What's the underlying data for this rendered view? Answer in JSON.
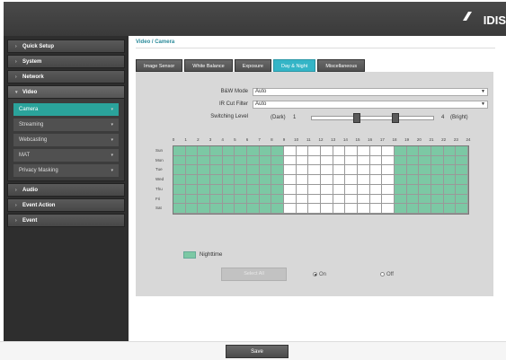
{
  "header": {
    "logo_text": "IDIS"
  },
  "sidebar": {
    "menus": [
      {
        "label": "Quick Setup",
        "open": false
      },
      {
        "label": "System",
        "open": false
      },
      {
        "label": "Network",
        "open": false
      },
      {
        "label": "Video",
        "open": true
      }
    ],
    "video_items": [
      {
        "label": "Camera",
        "active": true
      },
      {
        "label": "Streaming",
        "active": false
      },
      {
        "label": "Webcasting",
        "active": false
      },
      {
        "label": "MAT",
        "active": false
      },
      {
        "label": "Privacy Masking",
        "active": false
      }
    ],
    "menus_after": [
      {
        "label": "Audio"
      },
      {
        "label": "Event Action"
      },
      {
        "label": "Event"
      }
    ]
  },
  "breadcrumb": "Video / Camera",
  "tabs": [
    {
      "label": "Image Sensor",
      "active": false
    },
    {
      "label": "White Balance",
      "active": false
    },
    {
      "label": "Exposure",
      "active": false
    },
    {
      "label": "Day & Night",
      "active": true
    },
    {
      "label": "Miscellaneous",
      "active": false
    }
  ],
  "settings": {
    "bw_mode_label": "B&W Mode",
    "bw_mode_value": "Auto",
    "ir_cut_label": "IR Cut Filter",
    "ir_cut_value": "Auto",
    "switching_label": "Switching Level",
    "switching_left": "(Dark)",
    "switching_min": "1",
    "switching_max": "4",
    "switching_right": "(Bright)",
    "switching_knob_a": 2,
    "switching_knob_b": 3
  },
  "schedule": {
    "hours": [
      "0",
      "1",
      "2",
      "3",
      "4",
      "5",
      "6",
      "7",
      "8",
      "9",
      "10",
      "11",
      "12",
      "13",
      "14",
      "15",
      "16",
      "17",
      "18",
      "19",
      "20",
      "21",
      "22",
      "23",
      "24"
    ],
    "days": [
      "Sun",
      "Mon",
      "Tue",
      "Wed",
      "Thu",
      "Fri",
      "Sat"
    ],
    "night_hours": [
      0,
      1,
      2,
      3,
      4,
      5,
      6,
      7,
      8,
      18,
      19,
      20,
      21,
      22,
      23
    ],
    "legend_label": "Nighttime"
  },
  "select_all_label": "Select All",
  "radio_on_label": "On",
  "radio_off_label": "Off",
  "radio_selected": "On",
  "save_label": "Save",
  "colors": {
    "accent": "#34b5c7",
    "active_menu": "#2aa39b",
    "night_cell": "#7cc8a4"
  }
}
